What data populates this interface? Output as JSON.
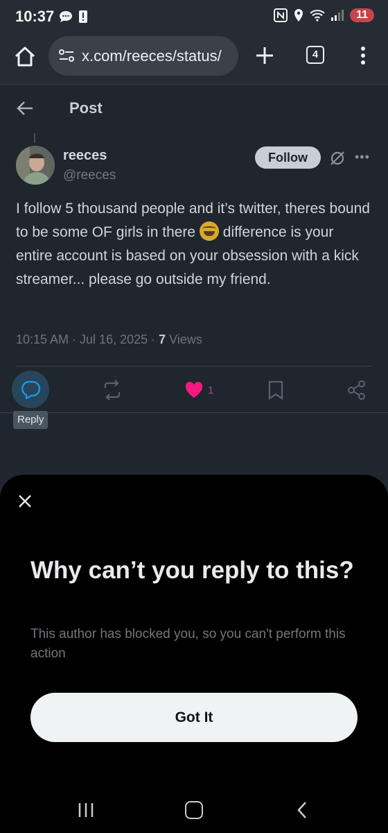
{
  "status_bar": {
    "time": "10:37",
    "battery": "11"
  },
  "browser": {
    "url": "x.com/reeces/status/",
    "tab_count": "4"
  },
  "header": {
    "title": "Post"
  },
  "post": {
    "display_name": "reeces",
    "handle": "@reeces",
    "follow_label": "Follow",
    "text_before_emoji": "I follow 5 thousand people and it’s twitter, theres bound to be some OF girls in there",
    "text_after_emoji": "difference is your entire account is based on your obsession with a kick streamer... please go outside my friend.",
    "timestamp": "10:15 AM · Jul 16, 2025 · ",
    "views_count": "7",
    "views_label": " Views",
    "like_count": "1",
    "reply_tooltip": "Reply"
  },
  "sheet": {
    "title": "Why can’t you reply to this?",
    "body": "This author has blocked you, so you can't perform this action",
    "button_label": "Got It"
  },
  "colors": {
    "like_pink": "#f91880",
    "reply_blue": "#1d9bf0",
    "background": "#1f262d",
    "sheet_background": "#000000"
  }
}
